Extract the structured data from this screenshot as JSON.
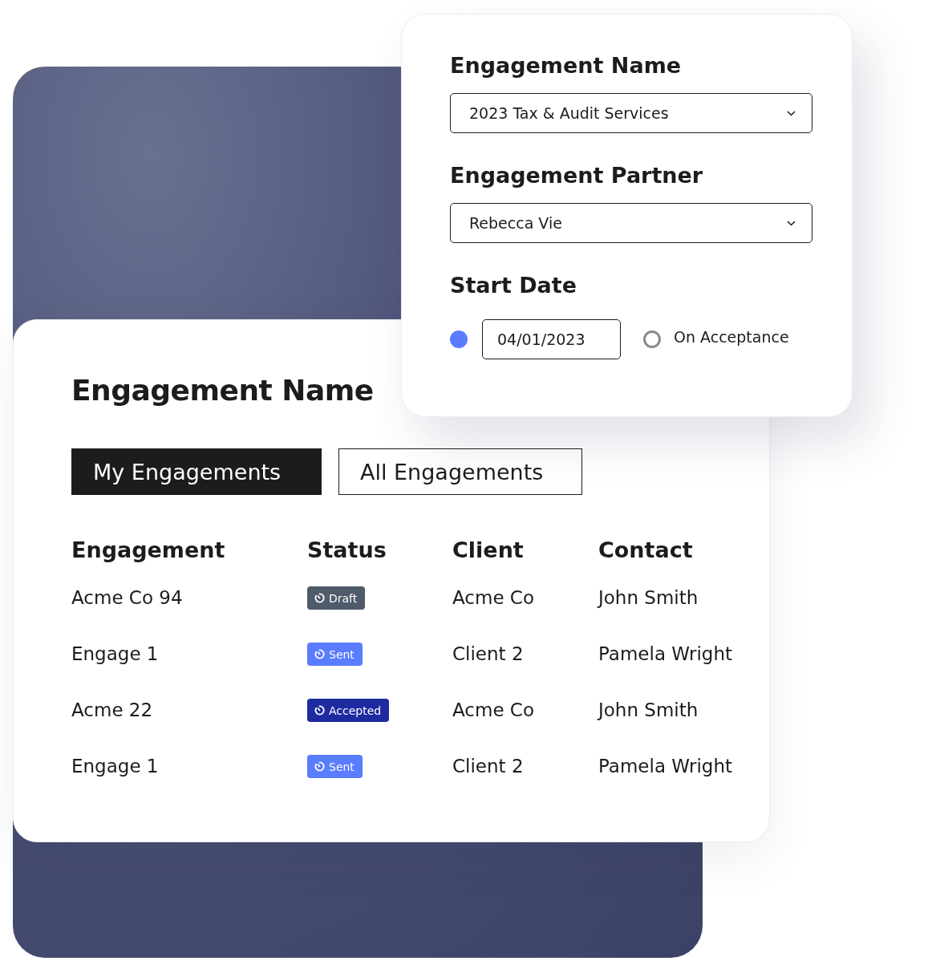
{
  "form_card": {
    "fields": [
      {
        "label": "Engagement Name",
        "value": "2023 Tax & Audit Services"
      },
      {
        "label": "Engagement Partner",
        "value": "Rebecca Vie"
      }
    ],
    "start_date": {
      "label": "Start Date",
      "options": [
        {
          "kind": "date",
          "value": "04/01/2023",
          "selected": true
        },
        {
          "kind": "text",
          "label": "On Acceptance",
          "selected": false
        }
      ]
    }
  },
  "list_card": {
    "title": "Engagement Name",
    "tabs": [
      {
        "label": "My Engagements",
        "selected": true
      },
      {
        "label": "All Engagements",
        "selected": false
      }
    ],
    "table": {
      "columns": [
        "Engagement",
        "Status",
        "Client",
        "Contact"
      ],
      "rows": [
        {
          "engagement": "Acme Co 94",
          "status": {
            "label": "Draft",
            "color": "#4f5a6b"
          },
          "client": "Acme Co",
          "contact": "John Smith"
        },
        {
          "engagement": "Engage 1",
          "status": {
            "label": "Sent",
            "color": "#5a7cff"
          },
          "client": "Client 2",
          "contact": "Pamela Wright"
        },
        {
          "engagement": "Acme 22",
          "status": {
            "label": "Accepted",
            "color": "#1e2aa0"
          },
          "client": "Acme Co",
          "contact": "John Smith"
        },
        {
          "engagement": "Engage 1",
          "status": {
            "label": "Sent",
            "color": "#5a7cff"
          },
          "client": "Client 2",
          "contact": "Pamela Wright"
        }
      ]
    }
  }
}
